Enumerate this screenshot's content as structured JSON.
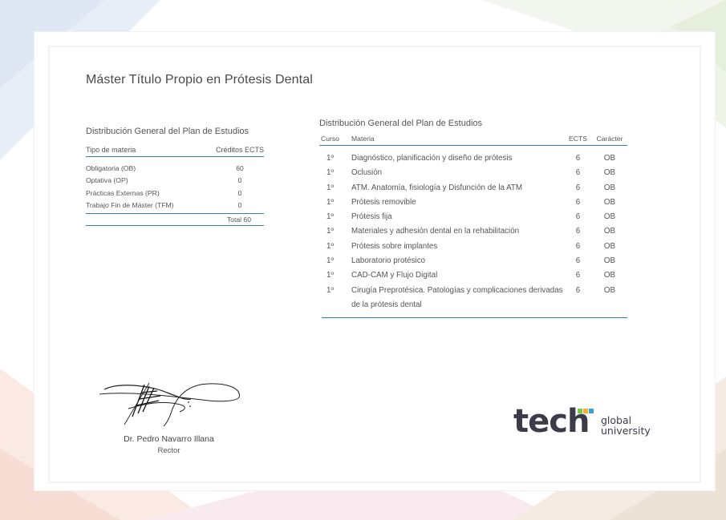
{
  "title": "Máster Título Propio en Prótesis Dental",
  "summary": {
    "heading": "Distribución General del Plan de Estudios",
    "col_type": "Tipo de materia",
    "col_credits": "Créditos ECTS",
    "rows": [
      {
        "type": "Obligatoria (OB)",
        "credits": "60"
      },
      {
        "type": "Optativa (OP)",
        "credits": "0"
      },
      {
        "type": "Prácticas Externas (PR)",
        "credits": "0"
      },
      {
        "type": "Trabajo Fin de Máster (TFM)",
        "credits": "0"
      }
    ],
    "total": "Total 60"
  },
  "detail": {
    "heading": "Distribución General del Plan de Estudios",
    "col_curso": "Curso",
    "col_materia": "Materia",
    "col_ects": "ECTS",
    "col_caracter": "Carácter",
    "rows": [
      {
        "curso": "1º",
        "materia": "Diagnóstico, planificación y diseño de prótesis",
        "ects": "6",
        "caracter": "OB"
      },
      {
        "curso": "1º",
        "materia": "Oclusión",
        "ects": "6",
        "caracter": "OB"
      },
      {
        "curso": "1º",
        "materia": "ATM. Anatomía, fisiología y Disfunción de la ATM",
        "ects": "6",
        "caracter": "OB"
      },
      {
        "curso": "1º",
        "materia": "Prótesis removible",
        "ects": "6",
        "caracter": "OB"
      },
      {
        "curso": "1º",
        "materia": "Prótesis fija",
        "ects": "6",
        "caracter": "OB"
      },
      {
        "curso": "1º",
        "materia": "Materiales y adhesión dental en la rehabilitación",
        "ects": "6",
        "caracter": "OB"
      },
      {
        "curso": "1º",
        "materia": "Prótesis sobre implantes",
        "ects": "6",
        "caracter": "OB"
      },
      {
        "curso": "1º",
        "materia": "Laboratorio protésico",
        "ects": "6",
        "caracter": "OB"
      },
      {
        "curso": "1º",
        "materia": "CAD-CAM y Flujo Digital",
        "ects": "6",
        "caracter": "OB"
      },
      {
        "curso": "1º",
        "materia": "Cirugía Preprotésica. Patologías y complicaciones derivadas de la prótesis dental",
        "ects": "6",
        "caracter": "OB"
      }
    ]
  },
  "signature": {
    "name": "Dr. Pedro Navarro Illana",
    "role": "Rector"
  },
  "logo": {
    "word": "tech",
    "line1": "global",
    "line2": "university"
  }
}
